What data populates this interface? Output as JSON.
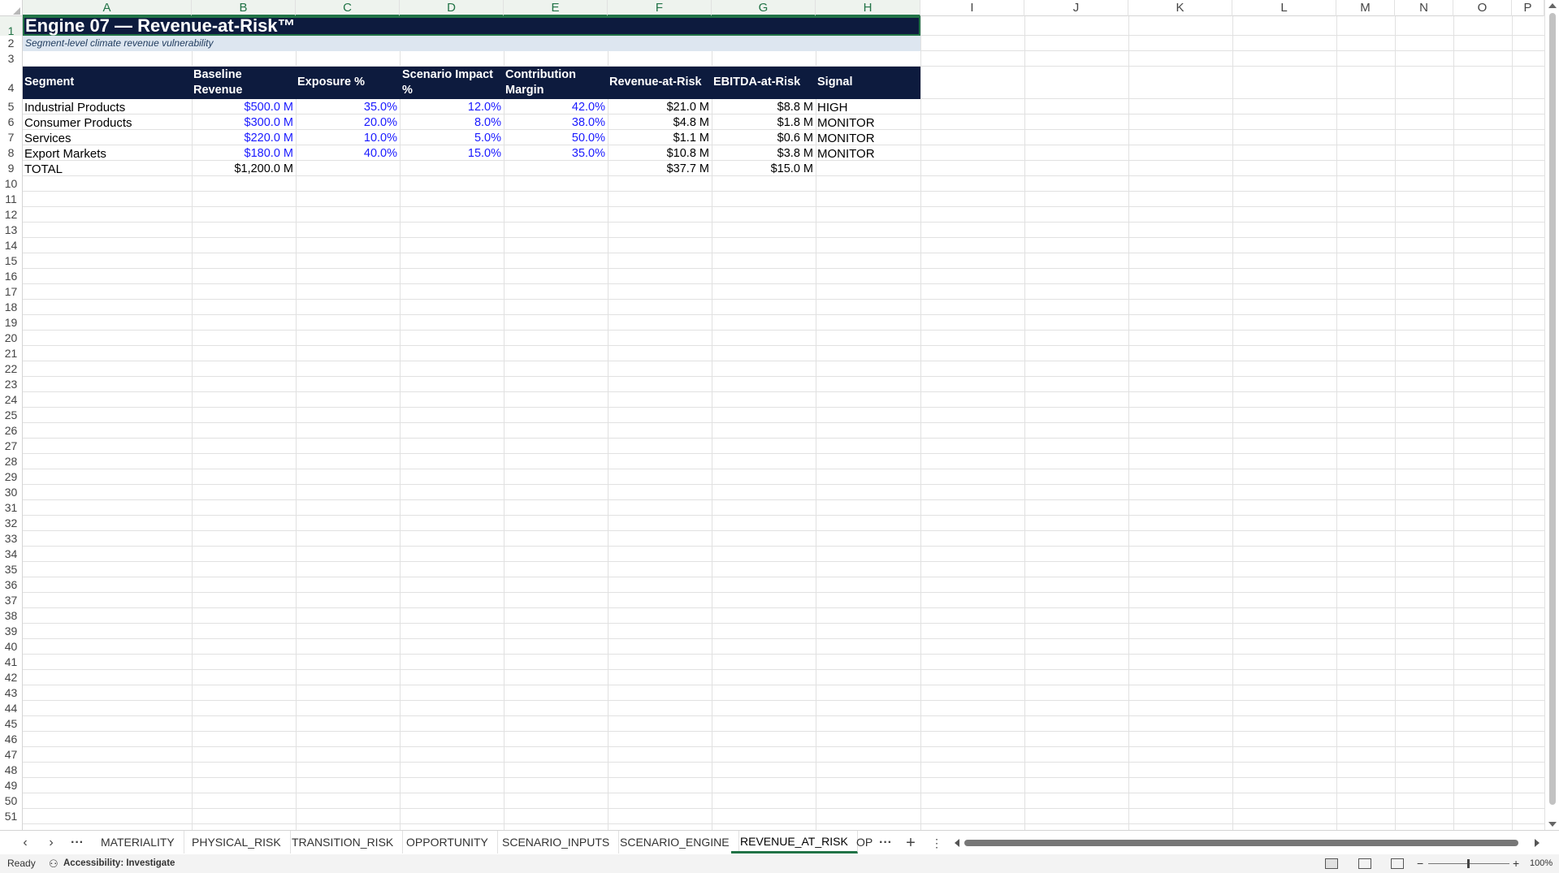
{
  "columns": [
    "A",
    "B",
    "C",
    "D",
    "E",
    "F",
    "G",
    "H",
    "I",
    "J",
    "K",
    "L",
    "M",
    "N",
    "O",
    "P"
  ],
  "rows": [
    1,
    2,
    3,
    4,
    5,
    6,
    7,
    8,
    9,
    10,
    11,
    12,
    13,
    14,
    15,
    16,
    17,
    18,
    19,
    20,
    21,
    22,
    23,
    24,
    25,
    26,
    27,
    28,
    29,
    30,
    31,
    32,
    33,
    34,
    35,
    36,
    37,
    38,
    39,
    40,
    41,
    42,
    43,
    44,
    45,
    46,
    47,
    48,
    49,
    50,
    51
  ],
  "sheet": {
    "title": "Engine 07 — Revenue-at-Risk™",
    "subtitle": "Segment-level climate revenue vulnerability",
    "headers": {
      "segment": "Segment",
      "baseline_revenue": "Baseline Revenue",
      "exposure": "Exposure %",
      "scenario_impact": "Scenario Impact %",
      "contribution_margin": "Contribution Margin",
      "revenue_at_risk": "Revenue-at-Risk",
      "ebitda_at_risk": "EBITDA-at-Risk",
      "signal": "Signal"
    },
    "data_rows": [
      {
        "segment": "Industrial Products",
        "baseline": "$500.0 M",
        "exposure": "35.0%",
        "impact": "12.0%",
        "margin": "42.0%",
        "rar": "$21.0 M",
        "ebitda": "$8.8 M",
        "signal": "HIGH"
      },
      {
        "segment": "Consumer Products",
        "baseline": "$300.0 M",
        "exposure": "20.0%",
        "impact": "8.0%",
        "margin": "38.0%",
        "rar": "$4.8 M",
        "ebitda": "$1.8 M",
        "signal": "MONITOR"
      },
      {
        "segment": "Services",
        "baseline": "$220.0 M",
        "exposure": "10.0%",
        "impact": "5.0%",
        "margin": "50.0%",
        "rar": "$1.1 M",
        "ebitda": "$0.6 M",
        "signal": "MONITOR"
      },
      {
        "segment": "Export Markets",
        "baseline": "$180.0 M",
        "exposure": "40.0%",
        "impact": "15.0%",
        "margin": "35.0%",
        "rar": "$10.8 M",
        "ebitda": "$3.8 M",
        "signal": "MONITOR"
      }
    ],
    "total": {
      "label": "TOTAL",
      "baseline": "$1,200.0 M",
      "rar": "$37.7 M",
      "ebitda": "$15.0 M"
    }
  },
  "tabs": {
    "items": [
      "MATERIALITY",
      "PHYSICAL_RISK",
      "TRANSITION_RISK",
      "OPPORTUNITY",
      "SCENARIO_INPUTS",
      "SCENARIO_ENGINE",
      "REVENUE_AT_RISK",
      "OP"
    ],
    "active": "REVENUE_AT_RISK",
    "prev_icon": "chevron-left-icon",
    "next_icon": "chevron-right-icon",
    "more_icon": "ellipsis-icon",
    "add_label": "+",
    "options_icon": "vertical-dots-icon"
  },
  "status": {
    "ready": "Ready",
    "accessibility": "Accessibility: Investigate",
    "zoom": "100%",
    "zoom_out": "−",
    "zoom_in": "+"
  },
  "colors": {
    "header_band": "#0d1b3e",
    "subtitle_band": "#dde6f0",
    "input_blue": "#1a1aff",
    "selection_green": "#217346"
  }
}
